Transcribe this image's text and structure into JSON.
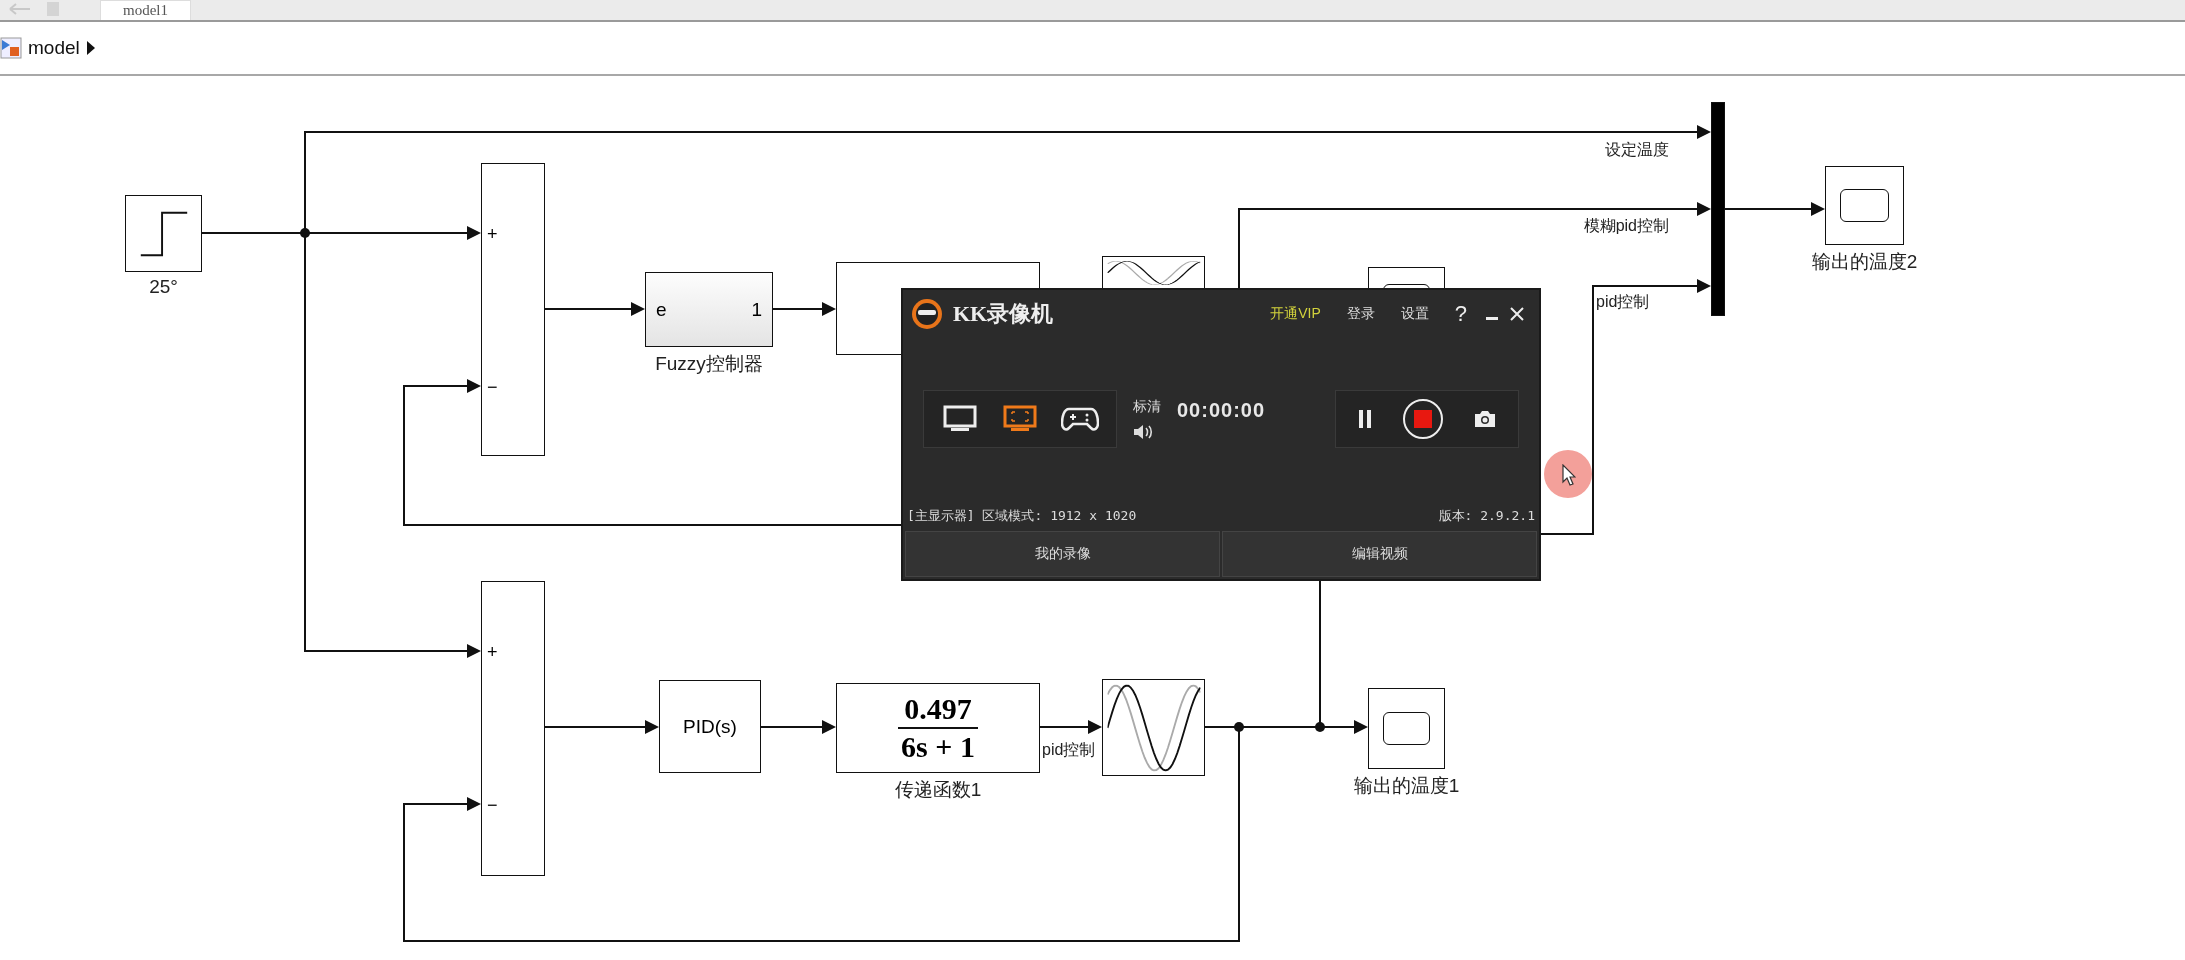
{
  "tabs": [
    {
      "label": "model1",
      "selected": true
    }
  ],
  "breadcrumb": {
    "label": "model"
  },
  "diagram": {
    "blocks": [
      {
        "kind": "step",
        "label": "25°"
      },
      {
        "kind": "sum",
        "signs": [
          "+",
          "−"
        ]
      },
      {
        "kind": "fuzzy",
        "input": "e",
        "output": "1",
        "label": "Fuzzy控制器"
      },
      {
        "kind": "transfer"
      },
      {
        "kind": "wave"
      },
      {
        "kind": "scope"
      },
      {
        "kind": "mux"
      },
      {
        "kind": "scope",
        "label": "输出的温度2"
      },
      {
        "kind": "sum",
        "signs": [
          "+",
          "−"
        ]
      },
      {
        "kind": "pid",
        "text": "PID(s)"
      },
      {
        "kind": "transfer",
        "numerator": "0.497",
        "denominator": "6s + 1",
        "label": "传递函数1"
      },
      {
        "kind": "wave"
      },
      {
        "kind": "scope",
        "label": "输出的温度1"
      }
    ],
    "signal_labels": [
      "设定温度",
      "模糊pid控制",
      "pid控制",
      "pid控制"
    ]
  },
  "recorder": {
    "title": "KK录像机",
    "menu": [
      {
        "label": "开通VIP",
        "kind": "vip"
      },
      {
        "label": "登录",
        "kind": "link"
      },
      {
        "label": "设置",
        "kind": "link"
      }
    ],
    "help": "?",
    "modes": [
      {
        "kind": "screen",
        "selected": false
      },
      {
        "kind": "region",
        "selected": true
      },
      {
        "kind": "game",
        "selected": false
      }
    ],
    "quality": "标清",
    "timer": "00:00:00",
    "status": "[主显示器] 区域模式: 1912 x 1020",
    "version": "版本: 2.9.2.1",
    "buttons": [
      "我的录像",
      "编辑视频"
    ]
  }
}
